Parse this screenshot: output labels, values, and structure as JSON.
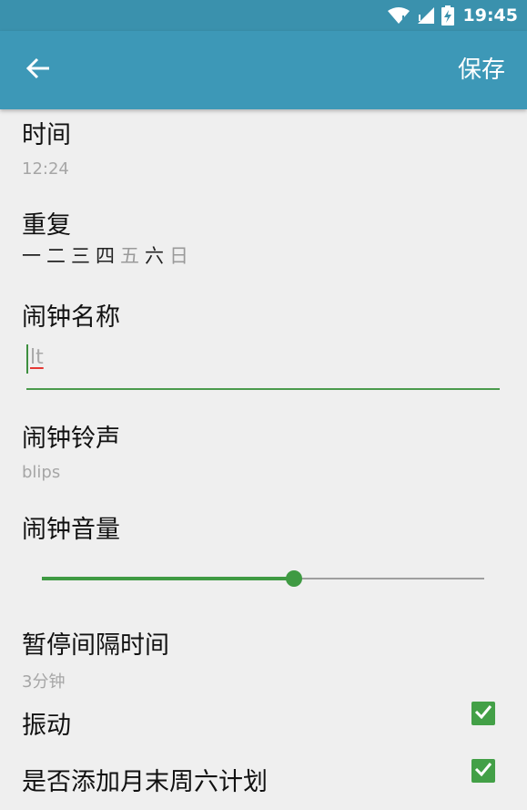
{
  "status_bar": {
    "time": "19:45",
    "icons": [
      "wifi-icon",
      "signal-icon",
      "battery-charging-icon"
    ]
  },
  "app_bar": {
    "back_icon": "arrow-left-icon",
    "save_label": "保存"
  },
  "settings": {
    "time": {
      "title": "时间",
      "value": "12:24"
    },
    "repeat": {
      "title": "重复",
      "days": [
        {
          "label": "一",
          "on": true
        },
        {
          "label": "二",
          "on": true
        },
        {
          "label": "三",
          "on": true
        },
        {
          "label": "四",
          "on": true
        },
        {
          "label": "五",
          "on": false
        },
        {
          "label": "六",
          "on": true
        },
        {
          "label": "日",
          "on": false
        }
      ]
    },
    "alarm_name": {
      "title": "闹钟名称",
      "value": "lt"
    },
    "ringtone": {
      "title": "闹钟铃声",
      "value": "blips"
    },
    "volume": {
      "title": "闹钟音量",
      "level_percent": 57
    },
    "snooze": {
      "title": "暂停间隔时间",
      "value": "3分钟"
    },
    "vibrate": {
      "title": "振动",
      "checked": true
    },
    "month_end_saturday": {
      "title": "是否添加月末周六计划",
      "checked": true
    }
  },
  "colors": {
    "status_bar": "#3a91ad",
    "app_bar": "#3d98b7",
    "accent": "#43a047"
  }
}
